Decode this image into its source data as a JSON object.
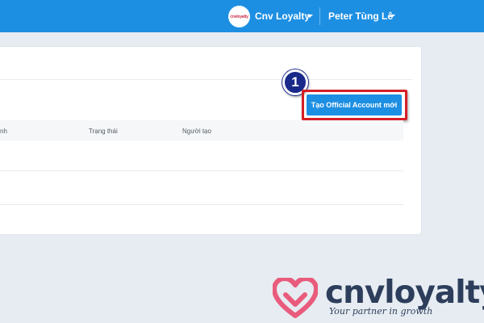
{
  "header": {
    "brand_logo_text": "cnvloyalty",
    "brand_name": "Cnv Loyalty",
    "user_name": "Peter Tùng Lê",
    "bar_color": "#1d8fe3"
  },
  "actions": {
    "create_oa_label": "Tạo Official Account mới",
    "step_number": "1",
    "highlight_color": "#d61f26"
  },
  "table": {
    "columns": [
      "nh",
      "Trạng thái",
      "Người tạo"
    ]
  },
  "watermark": {
    "brand": "cnvloyalty",
    "tagline": "Your partner in growth",
    "heart_color": "#e95b7c"
  }
}
